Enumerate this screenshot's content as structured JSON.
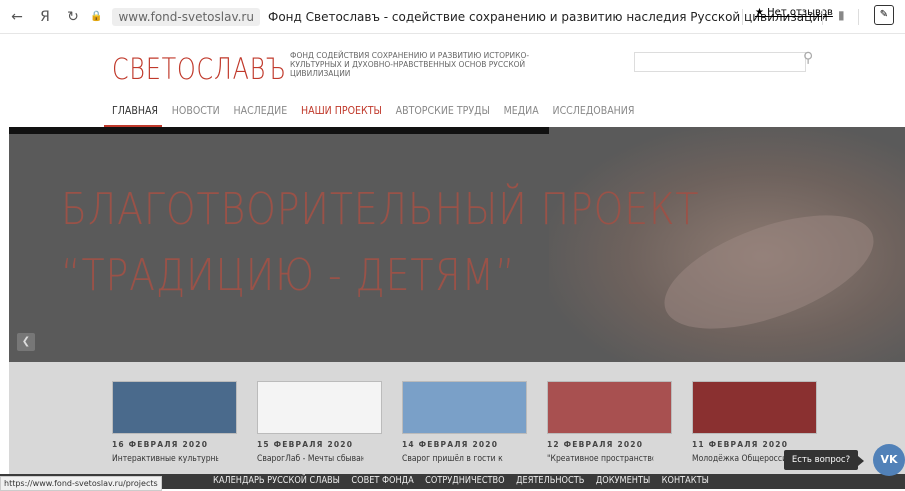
{
  "browser": {
    "back": "←",
    "yandex": "Я",
    "reload": "↻",
    "url": "www.fond-svetoslav.ru",
    "page_title": "Фонд Светославъ - содействие сохранению и развитию наследия Русской цивилизации",
    "reviews": "★ Нет отзывов"
  },
  "header": {
    "logo": "СВЕТОСЛАВЪ",
    "tagline": "ФОНД СОДЕЙСТВИЯ СОХРАНЕНИЮ И РАЗВИТИЮ ИСТОРИКО-КУЛЬТУРНЫХ И ДУХОВНО-НРАВСТВЕННЫХ ОСНОВ РУССКОЙ ЦИВИЛИЗАЦИИ",
    "search_placeholder": ""
  },
  "nav": {
    "items": [
      {
        "label": "ГЛАВНАЯ"
      },
      {
        "label": "НОВОСТИ"
      },
      {
        "label": "НАСЛЕДИЕ"
      },
      {
        "label": "НАШИ ПРОЕКТЫ"
      },
      {
        "label": "АВТОРСКИЕ ТРУДЫ"
      },
      {
        "label": "МЕДИА"
      },
      {
        "label": "ИССЛЕДОВАНИЯ"
      }
    ]
  },
  "hero": {
    "line1": "БЛАГОТВОРИТЕЛЬНЫЙ ПРОЕКТ",
    "line2": "“ТРАДИЦИЮ - ДЕТЯМ”"
  },
  "news": [
    {
      "date": "16 ФЕВРАЛЯ 2020",
      "title": "Интерактивные культурные",
      "thumb_color": "#4a6a8c"
    },
    {
      "date": "15 ФЕВРАЛЯ 2020",
      "title": "СварогЛаб - Мечты сбываются",
      "thumb_color": "#f4f4f4"
    },
    {
      "date": "14 ФЕВРАЛЯ 2020",
      "title": "Сварог пришёл в гости к",
      "thumb_color": "#7aa0c8"
    },
    {
      "date": "12 ФЕВРАЛЯ 2020",
      "title": "\"Креативное пространство",
      "thumb_color": "#a85050"
    },
    {
      "date": "11 ФЕВРАЛЯ 2020",
      "title": "Молодёжка Общероссийского",
      "thumb_color": "#8a3030"
    }
  ],
  "bottom_nav": {
    "items": [
      {
        "label": "КАЛЕНДАРЬ РУССКОЙ СЛАВЫ"
      },
      {
        "label": "СОВЕТ ФОНДА"
      },
      {
        "label": "СОТРУДНИЧЕСТВО"
      },
      {
        "label": "ДЕЯТЕЛЬНОСТЬ"
      },
      {
        "label": "ДОКУМЕНТЫ"
      },
      {
        "label": "КОНТАКТЫ"
      }
    ]
  },
  "status_url": "https://www.fond-svetoslav.ru/projects",
  "chat": {
    "label": "Есть вопрос?",
    "vk": "VK"
  },
  "colors": {
    "accent": "#c0392b",
    "hero_bg": "#5a5a5a",
    "vk": "#5181b8"
  }
}
